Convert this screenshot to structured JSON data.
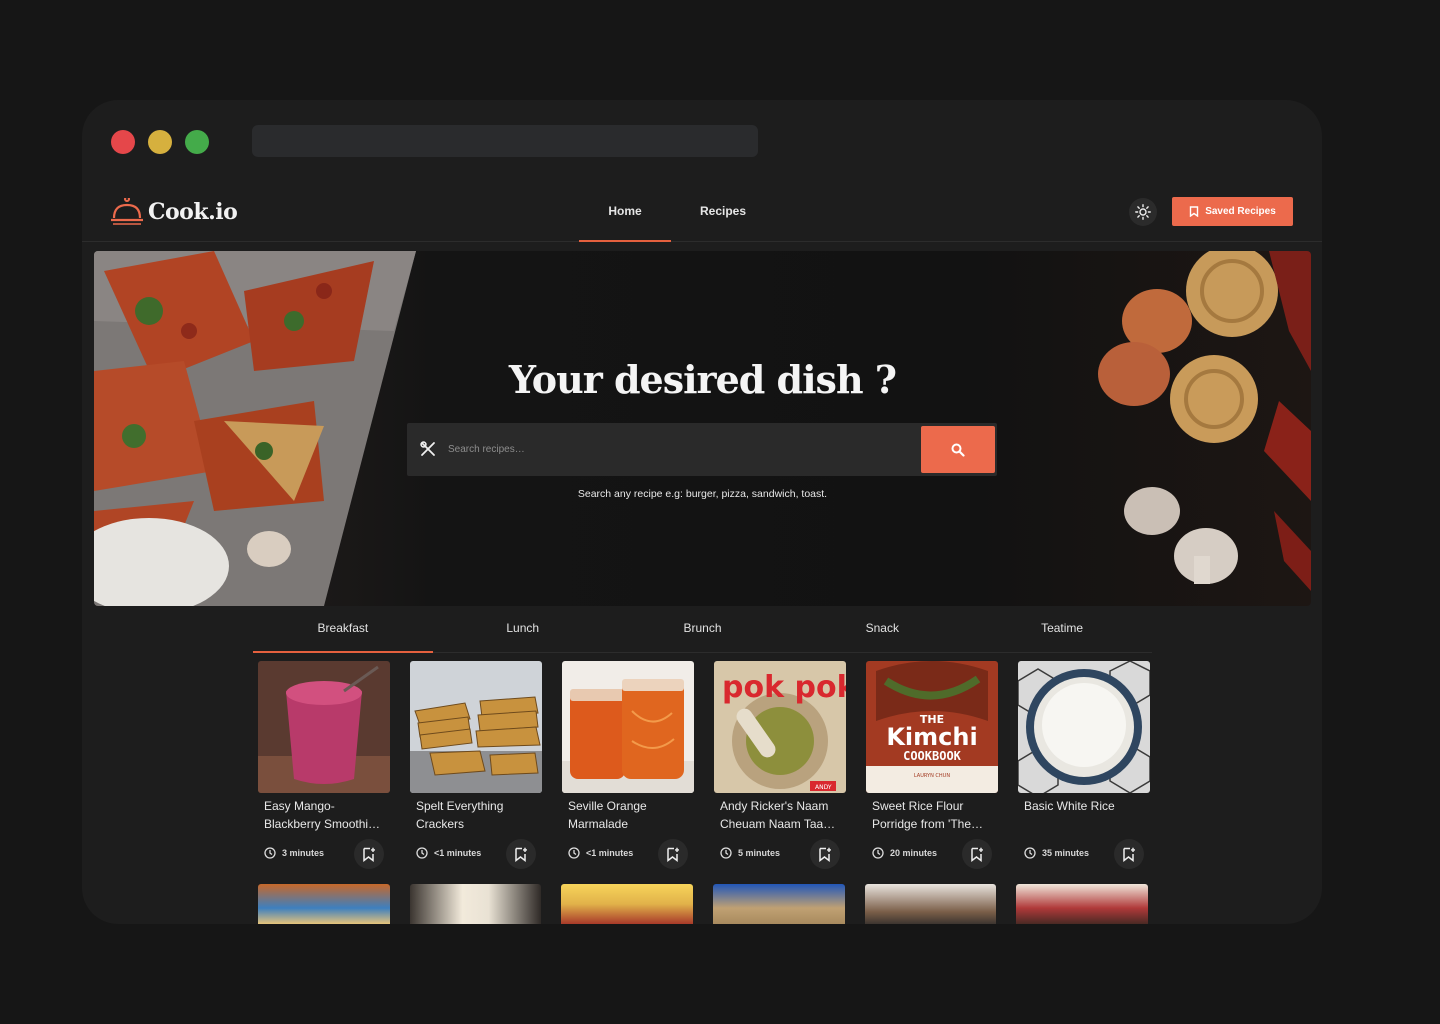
{
  "app": {
    "logo_text": "Cook.io",
    "accent_color": "#ec6a4c"
  },
  "nav": {
    "home": "Home",
    "recipes": "Recipes",
    "saved_label": "Saved Recipes",
    "theme_icon": "sun-icon"
  },
  "hero": {
    "title": "Your desired dish ?",
    "search_placeholder": "Search recipes…",
    "hint": "Search any recipe e.g: burger, pizza, sandwich, toast."
  },
  "tabs": [
    "Breakfast",
    "Lunch",
    "Brunch",
    "Snack",
    "Teatime"
  ],
  "active_tab": "Breakfast",
  "recipes": [
    {
      "title": "Easy Mango-Blackberry Smoothi…",
      "time": "3 minutes"
    },
    {
      "title": "Spelt Everything Crackers",
      "time": "<1 minutes"
    },
    {
      "title": "Seville Orange Marmalade",
      "time": "<1 minutes"
    },
    {
      "title": "Andy Ricker's Naam Cheuam Naam Taa…",
      "time": "5 minutes"
    },
    {
      "title": "Sweet Rice Flour Porridge from 'The…",
      "time": "20 minutes"
    },
    {
      "title": "Basic White Rice",
      "time": "35 minutes"
    }
  ],
  "book_covers": {
    "pokpok": "pok pok",
    "pokpok_author": "ANDY",
    "kimchi_the": "THE",
    "kimchi": "Kimchi",
    "kimchi_cookbook": "COOKBOOK",
    "kimchi_author": "LAURYN CHUN"
  }
}
